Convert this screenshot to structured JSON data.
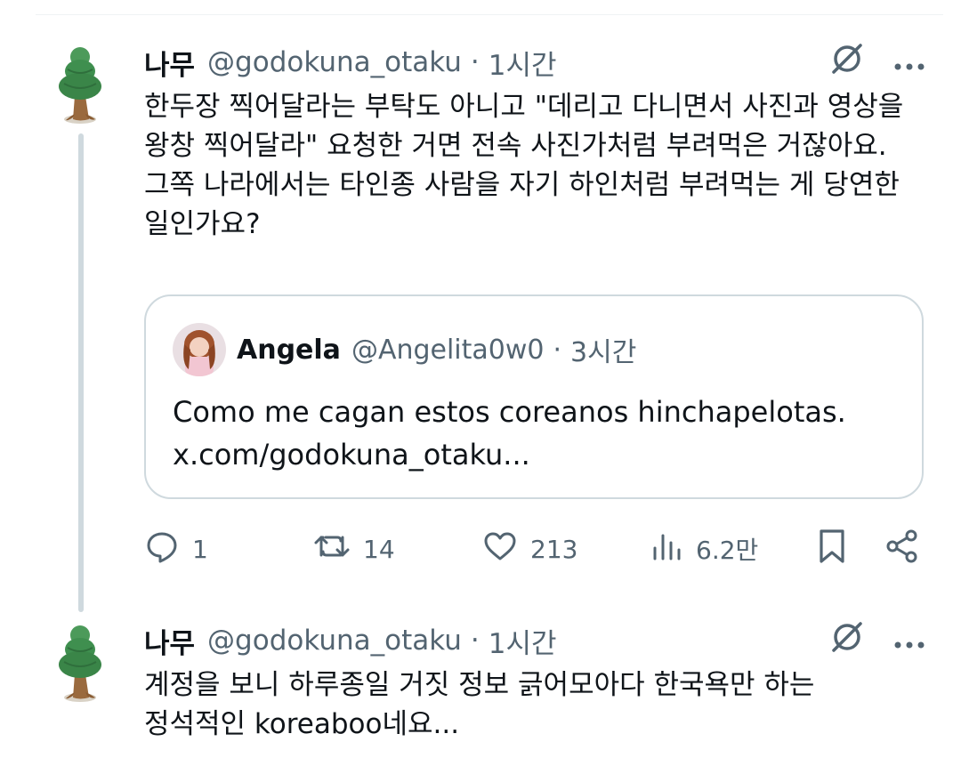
{
  "tweets": [
    {
      "display_name": "나무",
      "handle": "@godokuna_otaku",
      "separator": "·",
      "time": "1시간",
      "text": "한두장 찍어달라는 부탁도 아니고 \"데리고 다니면서 사진과 영상을 왕창 찍어달라\" 요청한 거면 전속 사진가처럼 부려먹은 거잖아요. 그쪽 나라에서는 타인종 사람을 자기 하인처럼 부려먹는 게 당연한 일인가요?"
    },
    {
      "display_name": "나무",
      "handle": "@godokuna_otaku",
      "separator": "·",
      "time": "1시간",
      "text": "계정을 보니 하루종일 거짓 정보 긁어모아다 한국욕만 하는 정석적인 koreaboo네요..."
    }
  ],
  "quote": {
    "display_name": "Angela",
    "handle": "@Angelita0w0",
    "separator": "·",
    "time": "3시간",
    "text": "Como me cagan estos coreanos hinchapelotas.\nx.com/godokuna_otaku..."
  },
  "actions": {
    "reply": {
      "icon": "reply-icon",
      "count": "1"
    },
    "retweet": {
      "icon": "retweet-icon",
      "count": "14"
    },
    "like": {
      "icon": "heart-icon",
      "count": "213"
    },
    "views": {
      "icon": "views-icon",
      "count": "6.2만"
    },
    "bookmark": {
      "icon": "bookmark-icon"
    },
    "share": {
      "icon": "share-icon"
    }
  },
  "colors": {
    "text": "#0f1419",
    "secondary": "#536471",
    "border": "#cfd9de",
    "tree_foliage": "#3f8f4f",
    "tree_trunk": "#9a6a3e"
  }
}
